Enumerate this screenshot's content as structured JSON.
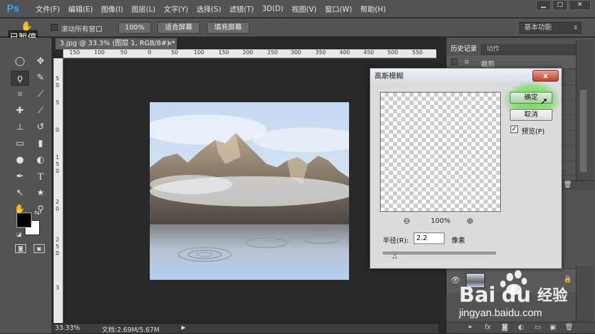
{
  "app": {
    "logo": "Ps"
  },
  "menu": [
    "文件(F)",
    "编辑(E)",
    "图像(I)",
    "图层(L)",
    "文字(Y)",
    "选择(S)",
    "滤镜(T)",
    "3D(D)",
    "视图(V)",
    "窗口(W)",
    "帮助(H)"
  ],
  "window_buttons": [
    "▁",
    "□",
    "✕"
  ],
  "overlay_caption": "已暂停",
  "options": {
    "scroll_all_label": "滚动所有窗口",
    "zoom_100": "100%",
    "fit_screen": "适合屏幕",
    "fill_screen": "填充屏幕",
    "workspace": "基本功能"
  },
  "document": {
    "tab_title": "3.jpg @ 33.3% (图层 1, RGB/8#) *",
    "close_glyph": "×"
  },
  "ruler": {
    "top_ticks": [
      "150",
      "100",
      "50",
      "0",
      "50",
      "100",
      "150",
      "200",
      "250",
      "300",
      "350",
      "400",
      "450",
      "500",
      "550"
    ],
    "left_ticks": [
      "5",
      "0",
      "5",
      "0",
      "1",
      "5",
      "0",
      "2",
      "0",
      "2",
      "5",
      "0",
      "3"
    ]
  },
  "status": {
    "zoom": "33.33%",
    "doc_size": "文档:2.69M/5.67M"
  },
  "panels": {
    "history_tab": "历史记录",
    "actions_tab": "动作",
    "history_item": "裁剪"
  },
  "dialog": {
    "title": "高斯模糊",
    "close_glyph": "x",
    "ok": "确定",
    "cancel": "取消",
    "preview_label": "预览(P)",
    "preview_checked": true,
    "zoom_value": "100%",
    "radius_label": "半径(R):",
    "radius_value": "2.2",
    "radius_unit": "像素"
  },
  "watermark": {
    "url": "jingyan.baidu.com"
  },
  "colors": {
    "foreground": "#000000",
    "background": "#ffffff",
    "ps_blue": "#31a8ff",
    "accent_green": "#5adc3c"
  }
}
